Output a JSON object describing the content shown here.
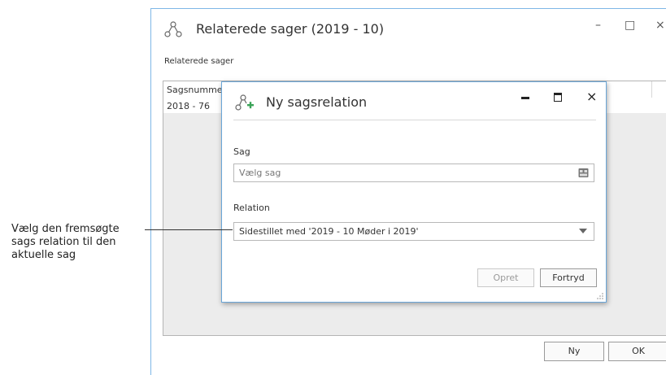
{
  "background_window": {
    "title": "Relaterede sager (2019 - 10)",
    "minimize": "–",
    "maximize": "□",
    "close": "×",
    "section_label": "Relaterede sager",
    "grid": {
      "columns": [
        "Sagsnumme"
      ],
      "rows": [
        [
          "2018 - 76"
        ]
      ]
    },
    "buttons": {
      "new": "Ny",
      "ok": "OK"
    }
  },
  "dialog": {
    "title": "Ny sagsrelation",
    "minimize": "–",
    "maximize": "■",
    "close": "×",
    "case_label": "Sag",
    "case_placeholder": "Vælg sag",
    "relation_label": "Relation",
    "relation_value": "Sidestillet med '2019 - 10 Møder i 2019'",
    "buttons": {
      "create": "Opret",
      "cancel": "Fortryd"
    }
  },
  "annotation": {
    "lines": [
      "Vælg den fremsøgte",
      "sags relation til den",
      "aktuelle sag"
    ]
  },
  "colors": {
    "window_border": "#7fb7e6",
    "dialog_border": "#6aa6d8",
    "icon_green": "#3aa357"
  }
}
